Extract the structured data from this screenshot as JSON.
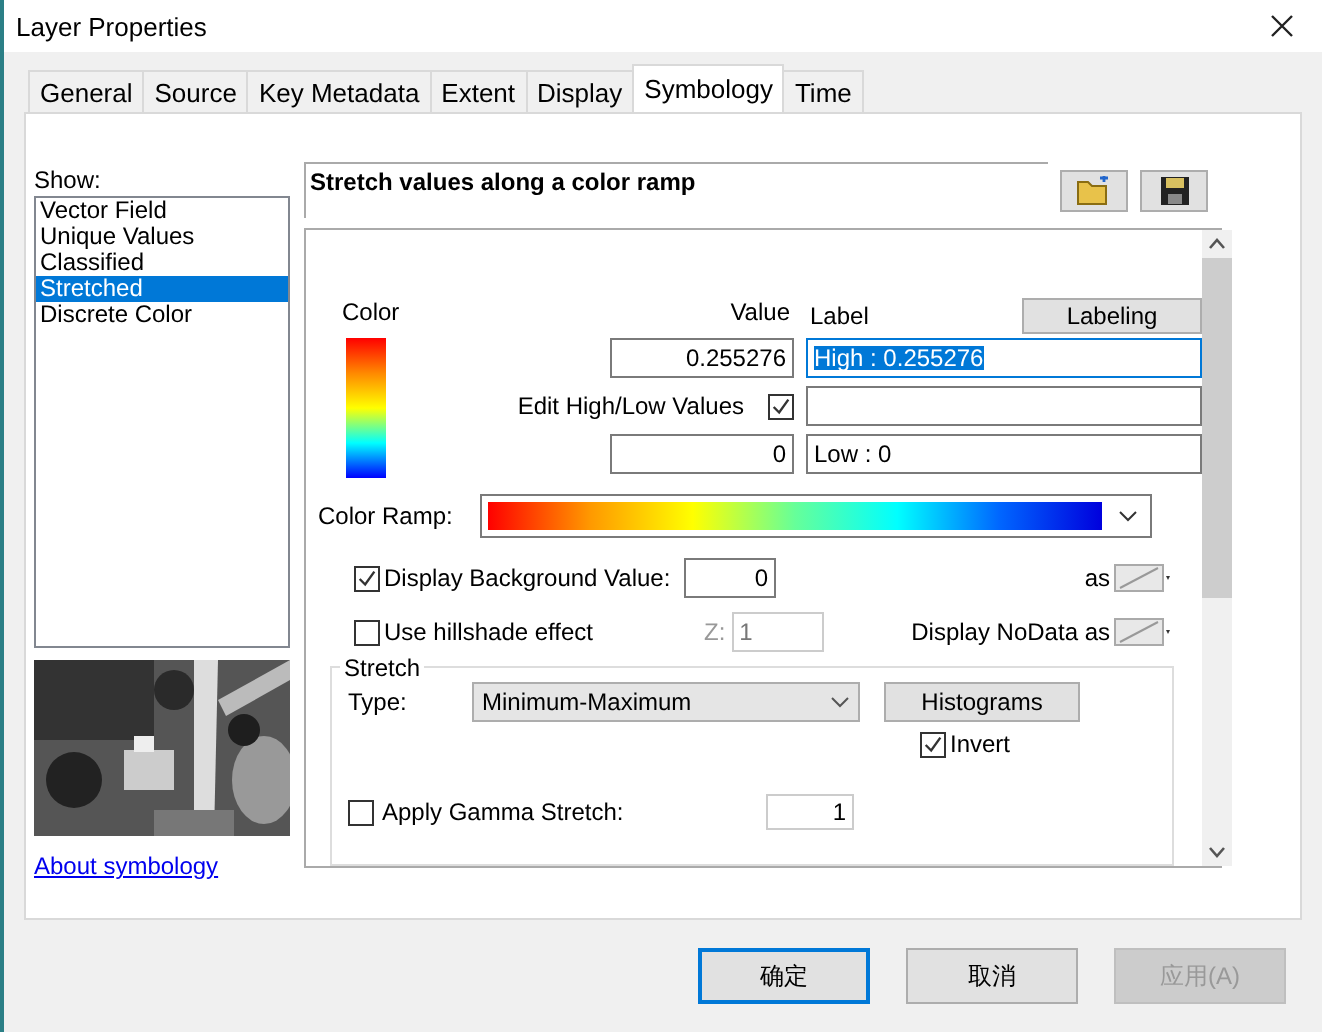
{
  "window": {
    "title": "Layer Properties"
  },
  "tabs": [
    {
      "label": "General",
      "selected": false
    },
    {
      "label": "Source",
      "selected": false
    },
    {
      "label": "Key Metadata",
      "selected": false
    },
    {
      "label": "Extent",
      "selected": false
    },
    {
      "label": "Display",
      "selected": false
    },
    {
      "label": "Symbology",
      "selected": true
    },
    {
      "label": "Time",
      "selected": false
    }
  ],
  "show": {
    "label": "Show:",
    "items": [
      {
        "label": "Vector Field",
        "selected": false
      },
      {
        "label": "Unique Values",
        "selected": false
      },
      {
        "label": "Classified",
        "selected": false
      },
      {
        "label": "Stretched",
        "selected": true
      },
      {
        "label": "Discrete Color",
        "selected": false
      }
    ]
  },
  "about_link": "About symbology",
  "renderer_title": "Stretch values along a color ramp",
  "headers": {
    "ramp": "Color",
    "value": "Value",
    "label": "Label"
  },
  "labeling_button": "Labeling",
  "high": {
    "value": "0.255276",
    "label": "High : 0.255276",
    "label_highlighted": true
  },
  "edit_high_low": {
    "label": "Edit High/Low Values",
    "checked": true
  },
  "low": {
    "value": "0",
    "label": "Low : 0",
    "label_highlighted": false
  },
  "color_ramp": {
    "label": "Color Ramp:"
  },
  "background": {
    "label": "Display Background Value:",
    "checked": true,
    "value": "0",
    "as_label": "as"
  },
  "hillshade": {
    "label": "Use hillshade effect",
    "checked": false,
    "z_label": "Z:",
    "z_value": "1"
  },
  "nodata": {
    "label": "Display NoData as"
  },
  "stretch": {
    "group_label": "Stretch",
    "type_label": "Type:",
    "type_value": "Minimum-Maximum",
    "histograms_button": "Histograms",
    "invert": {
      "label": "Invert",
      "checked": true
    }
  },
  "gamma": {
    "label": "Apply Gamma Stretch:",
    "checked": false,
    "value": "1"
  },
  "buttons": [
    {
      "label": "确定",
      "default": true,
      "disabled": false
    },
    {
      "label": "取消",
      "default": false,
      "disabled": false
    },
    {
      "label": "应用(A)",
      "default": false,
      "disabled": true
    }
  ]
}
